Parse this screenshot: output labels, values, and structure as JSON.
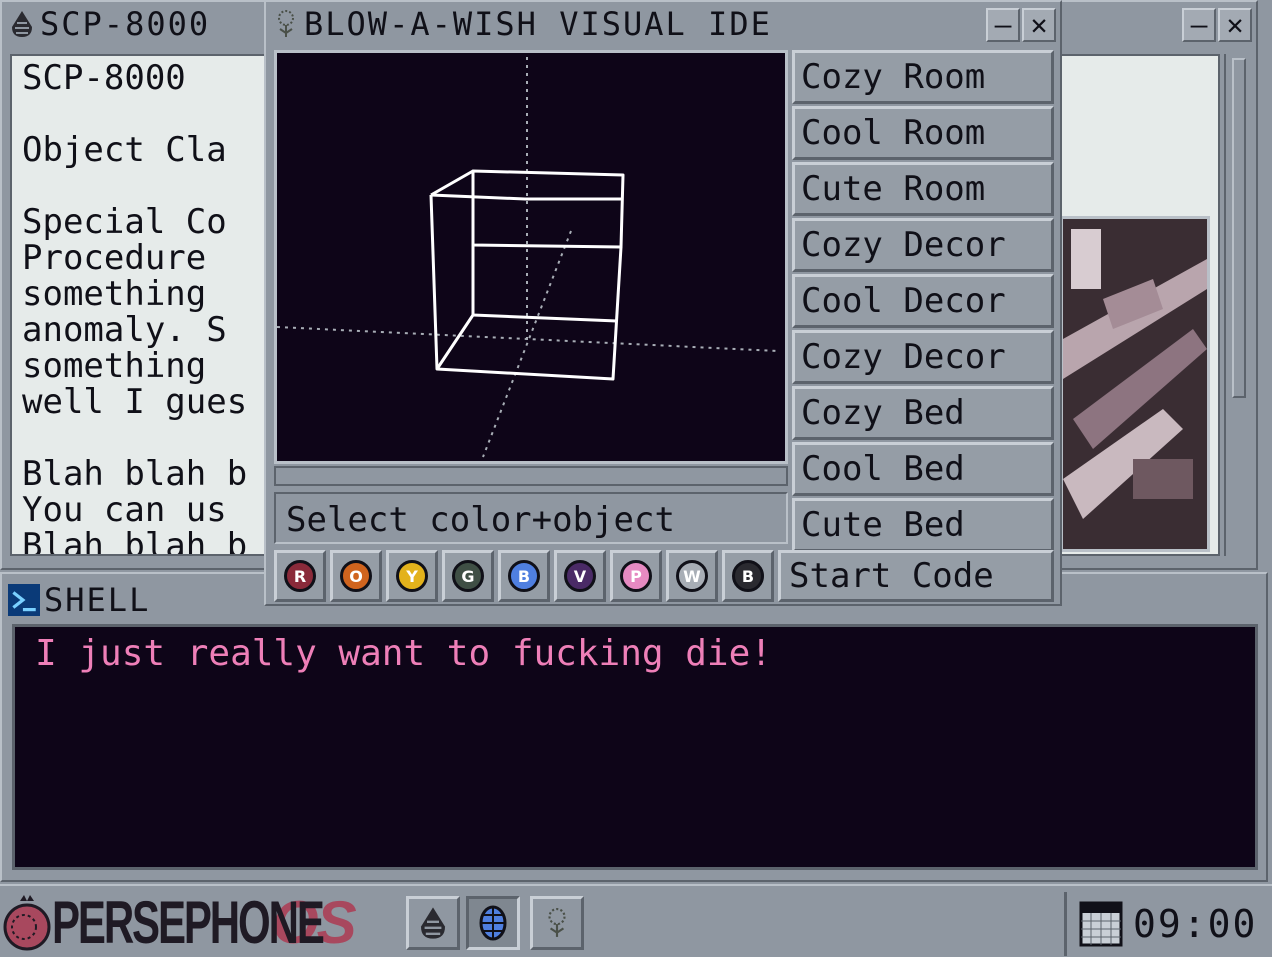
{
  "scp_window": {
    "title": "SCP-8000",
    "icon": "persephone-seed-icon",
    "minimize_label": "–",
    "close_label": "✕",
    "text_lines": [
      "SCP-8000",
      "",
      "Object Cla",
      "",
      "Special Co",
      "Procedure",
      "something",
      "anomaly. S",
      "something",
      "well I gues",
      "",
      "Blah blah b",
      "You can us",
      "Blah blah b"
    ]
  },
  "ide_window": {
    "title": "BLOW-A-WISH VISUAL IDE",
    "icon": "dandelion-icon",
    "minimize_label": "–",
    "close_label": "✕",
    "status": "Select color+object",
    "object_buttons": [
      "Cozy Room",
      "Cool Room",
      "Cute Room",
      "Cozy Decor",
      "Cool Decor",
      "Cozy Decor",
      "Cozy Bed",
      "Cool Bed",
      "Cute Bed"
    ],
    "color_buttons": [
      {
        "letter": "R",
        "color": "#8a2a3a"
      },
      {
        "letter": "O",
        "color": "#d0641e"
      },
      {
        "letter": "Y",
        "color": "#e3b21c"
      },
      {
        "letter": "G",
        "color": "#3f4f45"
      },
      {
        "letter": "B",
        "color": "#4f7fe0"
      },
      {
        "letter": "V",
        "color": "#4a2a66"
      },
      {
        "letter": "P",
        "color": "#e68ac2"
      },
      {
        "letter": "W",
        "color": "#a8aeb6"
      },
      {
        "letter": "B",
        "color": "#2a2a30"
      }
    ],
    "start_label": "Start Code"
  },
  "shell_window": {
    "title": "SHELL",
    "icon": "terminal-icon",
    "output": "I just really want to fucking die!"
  },
  "taskbar": {
    "os_name_part1": "PERSEPHONE",
    "os_name_part2": "OS",
    "apps": [
      {
        "name": "persephone-seed-icon",
        "active": false
      },
      {
        "name": "globe-icon",
        "active": true
      },
      {
        "name": "dandelion-icon",
        "active": false
      }
    ],
    "clock": "09:00"
  },
  "colors": {
    "chrome": "#8f97a1",
    "screen_bg": "#0e0518",
    "shell_text": "#ee7fb8",
    "accent_os": "#a8485e"
  }
}
